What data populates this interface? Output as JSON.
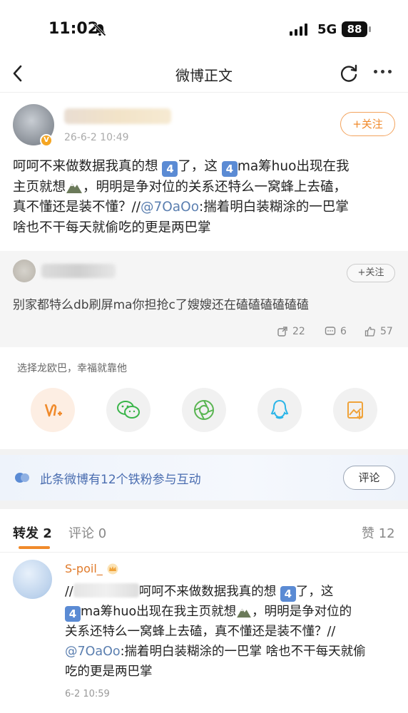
{
  "status": {
    "time": "11:02",
    "network": "5G",
    "battery": "88"
  },
  "nav": {
    "title": "微博正文"
  },
  "post": {
    "time": "26-6-2 10:49",
    "follow_label": "+关注",
    "line1_a": "呵呵不来做数据我真的想",
    "badge": "4",
    "line1_b": "了，这",
    "line1_c": "ma筹huo出现在我",
    "line2_a": "主页就想",
    "line2_b": "，明明是争对位的关系还特么一窝蜂上去磕，",
    "line3_a": "真不懂还是装不懂？//",
    "mention": "@7OaOo",
    "line3_b": ":揣着明白装糊涂的一巴掌",
    "line4": "啥也不干每天就偷吃的更是两巴掌"
  },
  "top_comment": {
    "follow_label": "+关注",
    "text": "别家都特么db刷屏ma你担抢c了嫂嫂还在磕磕磕磕磕磕",
    "reposts": "22",
    "comments": "6",
    "likes": "57"
  },
  "share": {
    "hint": "选择龙欧巴，幸福就靠他",
    "targets": [
      "weibo-icon",
      "wechat-icon",
      "moments-icon",
      "qq-icon",
      "save-image-icon"
    ]
  },
  "fans_banner": {
    "text": "此条微博有12个铁粉参与互动",
    "button": "评论"
  },
  "tabs": {
    "repost": "转发 2",
    "comment": "评论 0",
    "like": "赞 12"
  },
  "repost": {
    "name": "S-poil_",
    "prefix": "//",
    "line1": "呵呵不来做数据我真的想",
    "line1_b": "了，这",
    "line2_a": "ma筹huo出现在我主页就想",
    "line2_b": "，明明是争对位的",
    "line3": "关系还特么一窝蜂上去磕，真不懂还是装不懂？//",
    "mention": "@7OaOo",
    "line4": ":揣着明白装糊涂的一巴掌 啥也不干每天就偷",
    "line5": "吃的更是两巴掌",
    "time": "6-2 10:59"
  },
  "colors": {
    "accent": "#f08a2b",
    "link": "#5b7fb0",
    "badge": "#5b8bd4"
  }
}
